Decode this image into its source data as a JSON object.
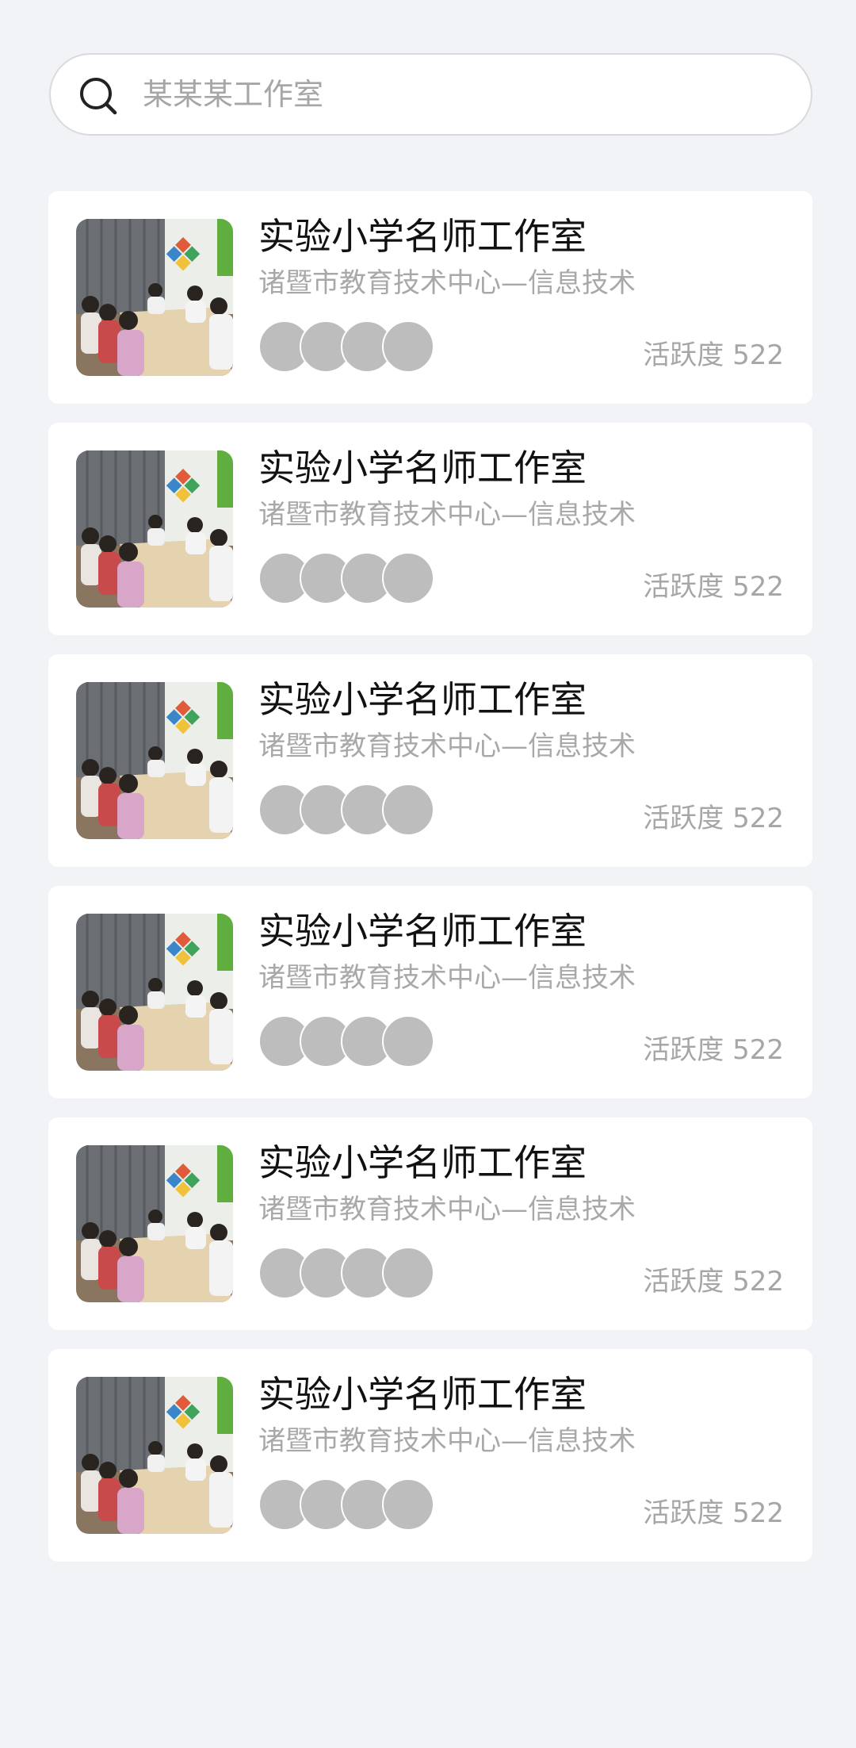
{
  "search": {
    "placeholder": "某某某工作室"
  },
  "cards": [
    {
      "title": "实验小学名师工作室",
      "subtitle": "诸暨市教育技术中心—信息技术",
      "activity": "活跃度 522"
    },
    {
      "title": "实验小学名师工作室",
      "subtitle": "诸暨市教育技术中心—信息技术",
      "activity": "活跃度 522"
    },
    {
      "title": "实验小学名师工作室",
      "subtitle": "诸暨市教育技术中心—信息技术",
      "activity": "活跃度 522"
    },
    {
      "title": "实验小学名师工作室",
      "subtitle": "诸暨市教育技术中心—信息技术",
      "activity": "活跃度 522"
    },
    {
      "title": "实验小学名师工作室",
      "subtitle": "诸暨市教育技术中心—信息技术",
      "activity": "活跃度 522"
    },
    {
      "title": "实验小学名师工作室",
      "subtitle": "诸暨市教育技术中心—信息技术",
      "activity": "活跃度 522"
    }
  ]
}
